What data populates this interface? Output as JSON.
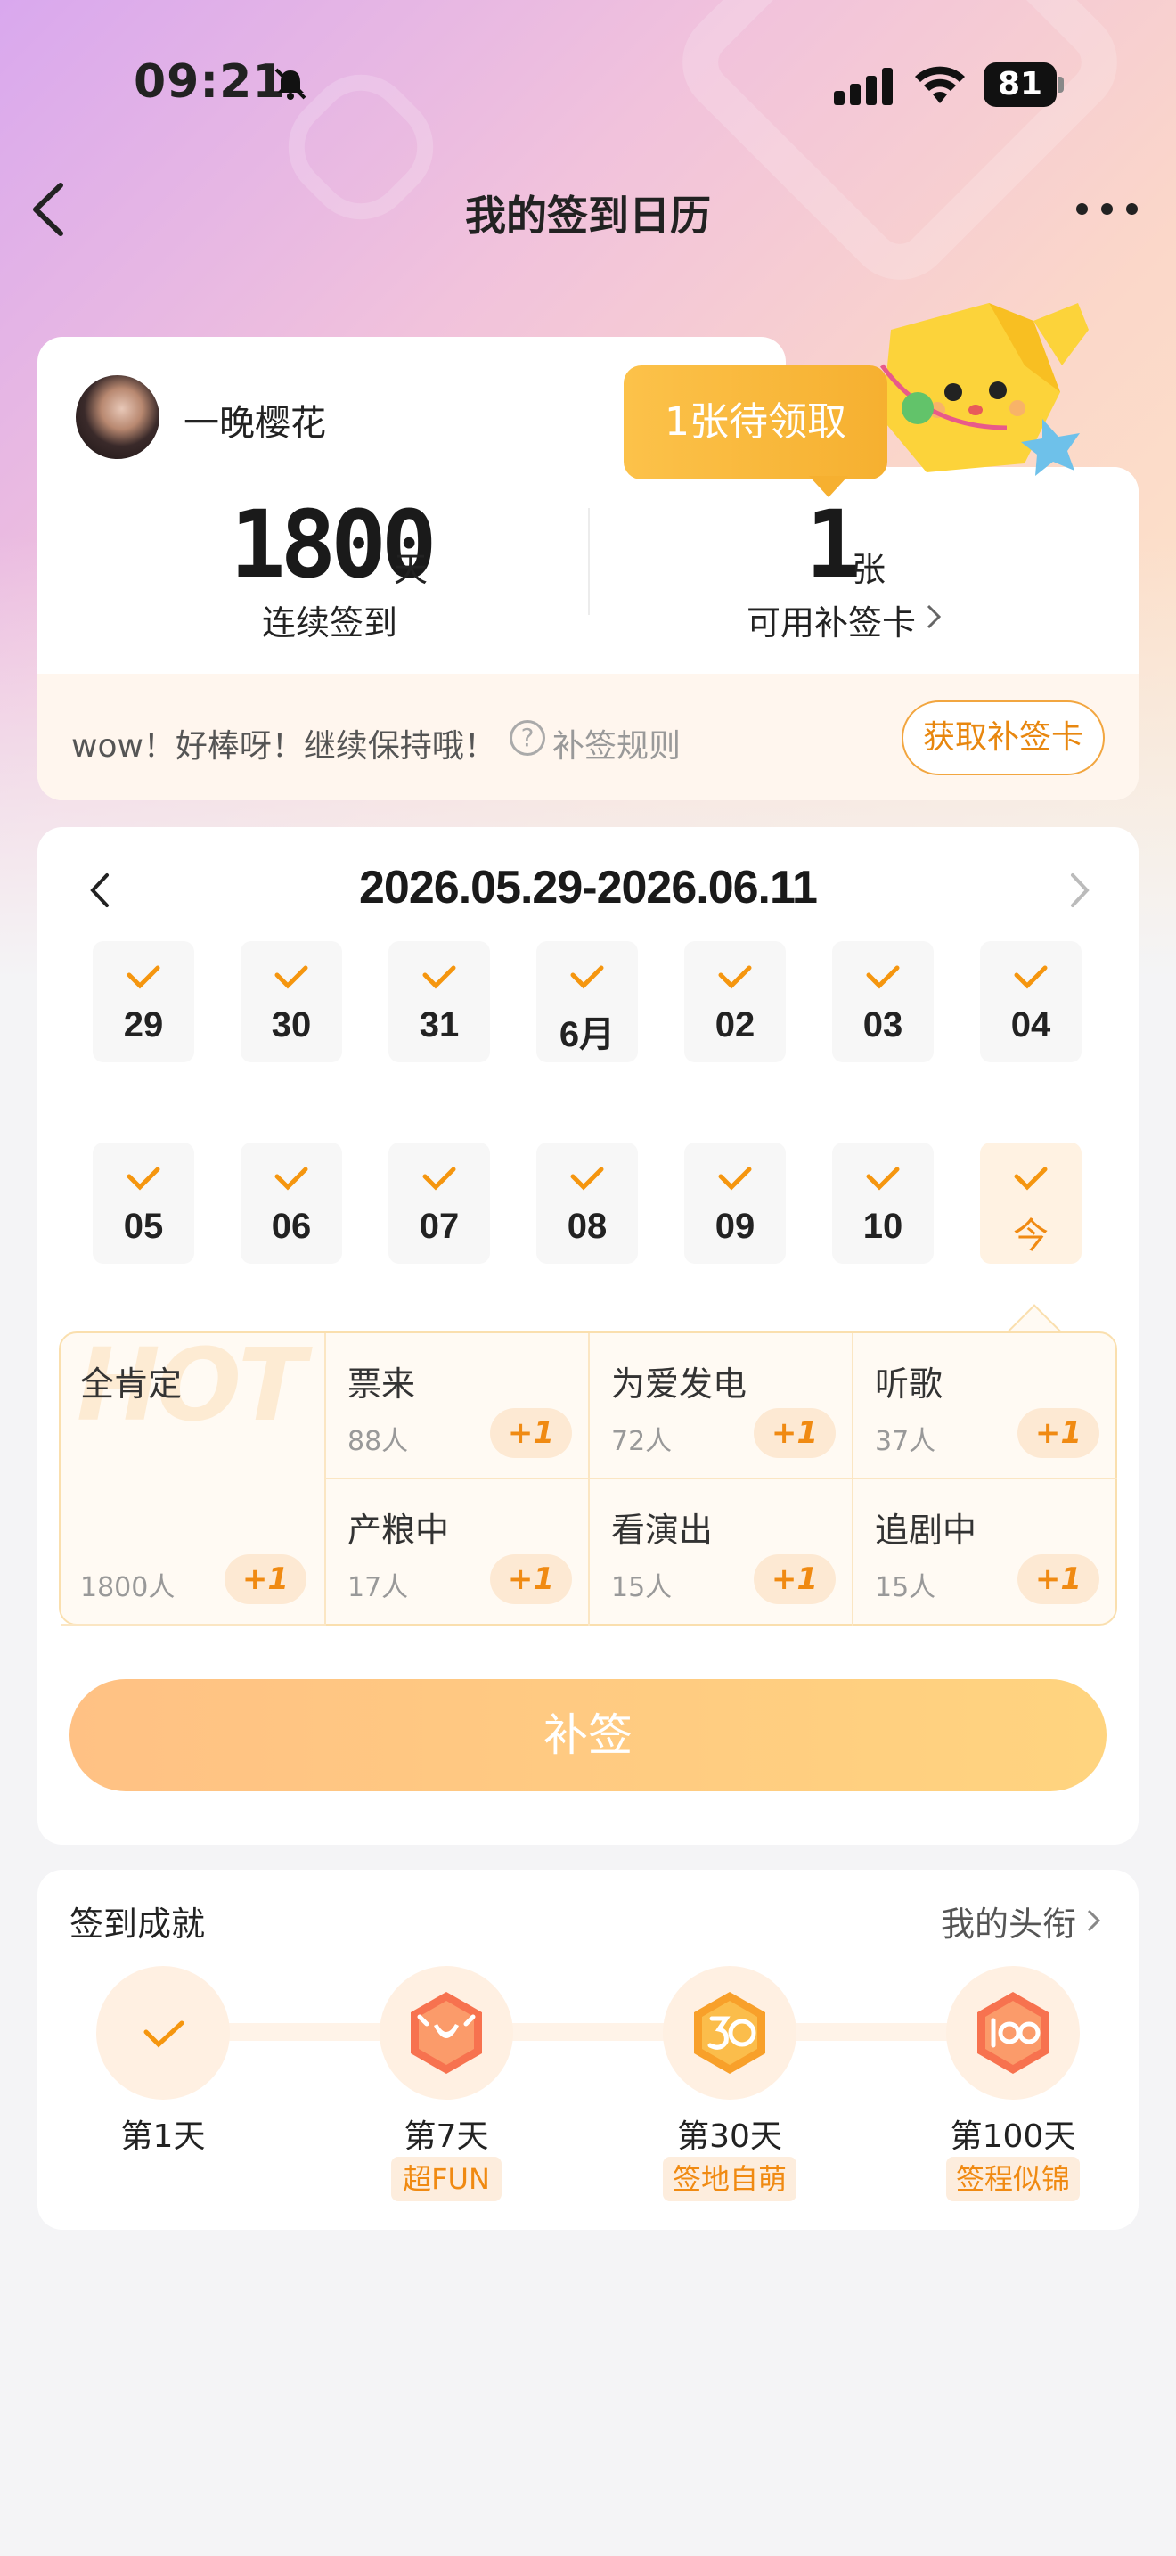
{
  "status_bar": {
    "time": "09:21",
    "battery": "81"
  },
  "nav": {
    "title": "我的签到日历"
  },
  "profile": {
    "username": "一晚樱花",
    "tooltip": "1张待领取",
    "streak_value": "1800",
    "streak_unit": "天",
    "streak_label": "连续签到",
    "cards_value": "1",
    "cards_unit": "张",
    "cards_label": "可用补签卡",
    "tip": "wow！好棒呀！继续保持哦！",
    "rule_label": "补签规则",
    "get_card_label": "获取补签卡"
  },
  "calendar": {
    "range": "2026.05.29-2026.06.11",
    "row1": [
      "29",
      "30",
      "31",
      "6月",
      "02",
      "03",
      "04"
    ],
    "row2": [
      "05",
      "06",
      "07",
      "08",
      "09",
      "10",
      "今"
    ],
    "hot_word": "HOT",
    "tags": [
      {
        "name": "全肯定",
        "count": "1800人",
        "plus": "+1"
      },
      {
        "name": "票来",
        "count": "88人",
        "plus": "+1"
      },
      {
        "name": "为爱发电",
        "count": "72人",
        "plus": "+1"
      },
      {
        "name": "听歌",
        "count": "37人",
        "plus": "+1"
      },
      {
        "name": "产粮中",
        "count": "17人",
        "plus": "+1"
      },
      {
        "name": "看演出",
        "count": "15人",
        "plus": "+1"
      },
      {
        "name": "追剧中",
        "count": "15人",
        "plus": "+1"
      }
    ],
    "makeup_button": "补签"
  },
  "achievements": {
    "title": "签到成就",
    "link": "我的头衔",
    "items": [
      {
        "day": "第1天",
        "tag": ""
      },
      {
        "day": "第7天",
        "tag": "超FUN"
      },
      {
        "day": "第30天",
        "tag": "签地自萌"
      },
      {
        "day": "第100天",
        "tag": "签程似锦"
      }
    ]
  },
  "colors": {
    "accent": "#f08a12",
    "tooltip": "#f6b030",
    "button_start": "#ffc184",
    "button_end": "#ffd47f"
  }
}
